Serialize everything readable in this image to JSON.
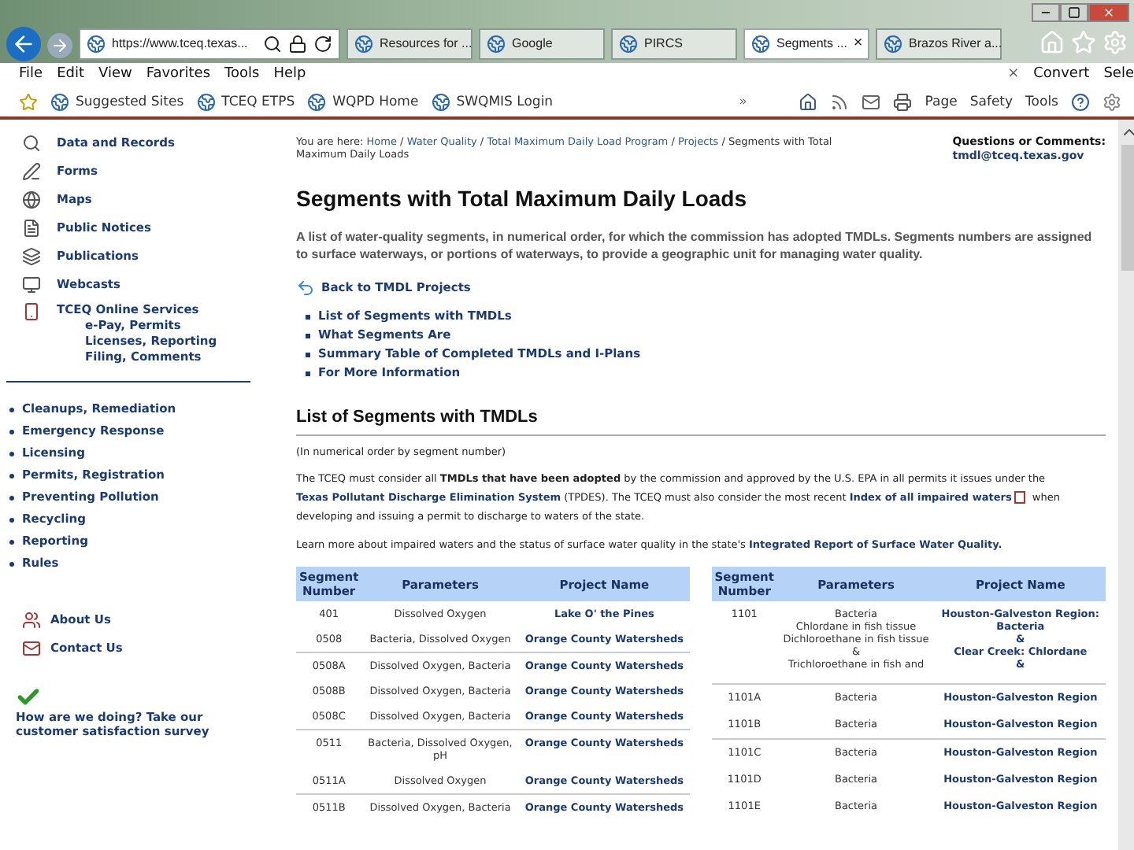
{
  "browser": {
    "address": "https://www.tceq.texas...",
    "tabs": [
      {
        "label": "Resources for ...",
        "selected": false
      },
      {
        "label": "Google",
        "selected": false
      },
      {
        "label": "PIRCS",
        "selected": false
      },
      {
        "label": "Segments ...",
        "selected": true,
        "close": "×"
      },
      {
        "label": "Brazos River a...",
        "selected": false
      }
    ],
    "menu": [
      "File",
      "Edit",
      "View",
      "Favorites",
      "Tools",
      "Help"
    ],
    "close_bar": "×",
    "convert": "Convert",
    "select": "Sele",
    "favorites": [
      "Suggested Sites",
      "TCEQ ETPS",
      "WQPD Home",
      "SWQMIS Login"
    ],
    "chevron": "»",
    "commands": [
      "Page",
      "Safety",
      "Tools"
    ]
  },
  "sidebar": {
    "items": [
      "Data and Records",
      "Forms",
      "Maps",
      "Public Notices",
      "Publications",
      "Webcasts"
    ],
    "online": {
      "title": "TCEQ Online Services",
      "lines": [
        "e-Pay, Permits",
        "Licenses, Reporting",
        "Filing, Comments"
      ]
    },
    "topics": [
      "Cleanups, Remediation",
      "Emergency Response",
      "Licensing",
      "Permits, Registration",
      "Preventing Pollution",
      "Recycling",
      "Reporting",
      "Rules"
    ],
    "about": [
      "About Us",
      "Contact Us"
    ],
    "survey": "How are we doing? Take our customer satisfaction survey"
  },
  "breadcrumb": {
    "prefix": "You are here:",
    "separator": "/",
    "links": [
      "Home",
      "Water Quality",
      "Total Maximum Daily Load Program",
      "Projects"
    ],
    "current": "Segments with Total Maximum Daily Loads"
  },
  "contact": {
    "label": "Questions or Comments:",
    "email": "tmdl@tceq.texas.gov"
  },
  "title": "Segments with Total Maximum Daily Loads",
  "intro": "A list of water-quality segments, in numerical order, for which the commission has adopted TMDLs. Segments numbers are assigned to surface waterways, or portions of waterways, to provide a geographic unit for managing water quality.",
  "back": "Back to TMDL Projects",
  "toc": [
    "List of Segments with TMDLs",
    "What Segments Are",
    "Summary Table of Completed TMDLs and I-Plans",
    "For More Information"
  ],
  "section": "List of Segments with TMDLs",
  "note": "(In numerical order by segment number)",
  "paragraphs": [
    [
      {
        "kind": "text",
        "text": "The TCEQ must consider all "
      },
      {
        "kind": "bold",
        "text": "TMDLs that have been adopted"
      },
      {
        "kind": "text",
        "text": " by the commission and approved by the U.S. EPA in all permits it issues under the "
      },
      {
        "kind": "link",
        "text": "Texas Pollutant Discharge Elimination System"
      },
      {
        "kind": "text",
        "text": " (TPDES). The TCEQ must also consider the most recent "
      },
      {
        "kind": "link",
        "text": "Index of all impaired waters"
      },
      {
        "kind": "pdf"
      },
      {
        "kind": "text",
        "text": " when developing and issuing a permit to discharge to waters of the state."
      }
    ],
    [
      {
        "kind": "text",
        "text": "Learn more about impaired waters and the status of surface water quality in the state's "
      },
      {
        "kind": "link",
        "text": "Integrated Report of Surface Water Quality."
      }
    ]
  ],
  "tables": [
    {
      "columns": [
        "Segment Number",
        "Parameters",
        "Project Name"
      ],
      "groups": [
        [
          [
            "401",
            [
              "Dissolved Oxygen"
            ],
            [
              "Lake O' the Pines"
            ]
          ],
          [
            "0508",
            [
              "Bacteria, Dissolved Oxygen"
            ],
            [
              "Orange County Watersheds"
            ]
          ]
        ],
        [
          [
            "0508A",
            [
              "Dissolved Oxygen, Bacteria"
            ],
            [
              "Orange County Watersheds"
            ]
          ],
          [
            "0508B",
            [
              "Dissolved Oxygen, Bacteria"
            ],
            [
              "Orange County Watersheds"
            ]
          ],
          [
            "0508C",
            [
              "Dissolved Oxygen, Bacteria"
            ],
            [
              "Orange County Watersheds"
            ]
          ]
        ],
        [
          [
            "0511",
            [
              "Bacteria, Dissolved Oxygen,",
              "pH"
            ],
            [
              "Orange County Watersheds"
            ]
          ],
          [
            "0511A",
            [
              "Dissolved Oxygen"
            ],
            [
              "Orange County Watersheds"
            ]
          ]
        ],
        [
          [
            "0511B",
            [
              "Dissolved Oxygen, Bacteria"
            ],
            [
              "Orange County Watersheds"
            ]
          ]
        ]
      ]
    },
    {
      "columns": [
        "Segment Number",
        "Parameters",
        "Project Name"
      ],
      "groups": [
        [
          [
            "1101",
            [
              "Bacteria",
              "Chlordane in fish tissue",
              "Dichloroethane in fish tissue",
              "&",
              "Trichloroethane in fish and"
            ],
            [
              "Houston-Galveston Region:",
              "Bacteria",
              "&",
              "Clear Creek: Chlordane",
              "&"
            ]
          ]
        ],
        [
          [
            "1101A",
            [
              "Bacteria"
            ],
            [
              "Houston-Galveston Region"
            ]
          ],
          [
            "1101B",
            [
              "Bacteria"
            ],
            [
              "Houston-Galveston Region"
            ]
          ]
        ],
        [
          [
            "1101C",
            [
              "Bacteria"
            ],
            [
              "Houston-Galveston Region"
            ]
          ],
          [
            "1101D",
            [
              "Bacteria"
            ],
            [
              "Houston-Galveston Region"
            ]
          ],
          [
            "1101E",
            [
              "Bacteria"
            ],
            [
              "Houston-Galveston Region"
            ]
          ]
        ]
      ]
    }
  ]
}
